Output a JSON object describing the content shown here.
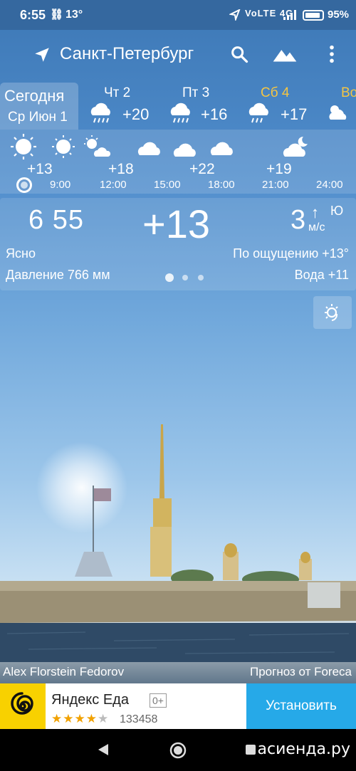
{
  "status_bar": {
    "time": "6:55",
    "temp": "13°",
    "system": "VoLTE 4G",
    "battery": "95%"
  },
  "toolbar": {
    "city": "Санкт-Петербург"
  },
  "day_tabs": [
    {
      "name": "Сегодня",
      "date": "Ср Июн 1"
    },
    {
      "name": "Чт 2",
      "temp": "+20",
      "icon": "rain-cloud-icon"
    },
    {
      "name": "Пт 3",
      "temp": "+16",
      "icon": "rain-cloud-icon"
    },
    {
      "name": "Сб 4",
      "temp": "+17",
      "icon": "rain-cloud-icon",
      "highlight_color": "#f5c542"
    },
    {
      "name": "Во",
      "icon": "partly-cloudy-icon"
    }
  ],
  "hourly": {
    "temps": [
      "+13",
      "+18",
      "+22",
      "+19"
    ],
    "times": [
      "9:00",
      "12:00",
      "15:00",
      "18:00",
      "21:00",
      "24:00"
    ],
    "icons": [
      "sun-icon",
      "sun-icon",
      "sun-cloud-icon",
      "cloud-icon",
      "cloud-icon",
      "cloud-icon",
      "moon-cloud-icon"
    ]
  },
  "current": {
    "clock": "6 55",
    "temp": "+13",
    "wind_speed": "3",
    "wind_dir": "Ю",
    "wind_unit": "м/с",
    "condition": "Ясно",
    "feels_like": "По ощущению +13°",
    "pressure": "Давление 766 мм",
    "water": "Вода +11"
  },
  "credits": {
    "photo": "Alex Florstein Fedorov",
    "forecast": "Прогноз от Foreca"
  },
  "ad": {
    "title": "Яндекс Еда",
    "age": "0+",
    "rating": 4,
    "count": "133458",
    "button": "Установить"
  },
  "watermark": "асиенда.ру",
  "colors": {
    "accent_day": "#f5c542",
    "ad_button": "#26a9e8",
    "ad_logo": "#f8d100"
  }
}
